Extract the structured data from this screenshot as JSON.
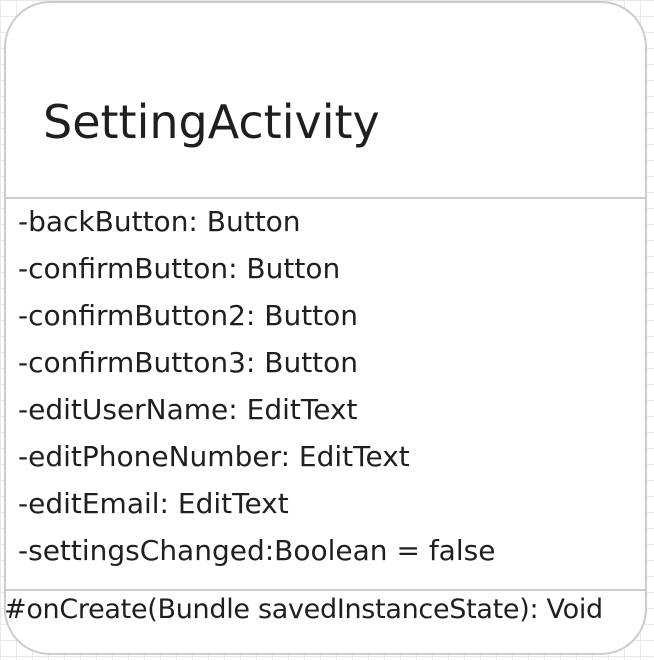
{
  "class": {
    "name": "SettingActivity",
    "attributes": [
      "-backButton: Button",
      "-confirmButton: Button",
      "-confirmButton2: Button",
      "-confirmButton3: Button",
      "-editUserName: EditText",
      "-editPhoneNumber: EditText",
      "-editEmail: EditText",
      "-settingsChanged:Boolean = false"
    ],
    "operations": [
      "#onCreate(Bundle savedInstanceState): Void"
    ]
  }
}
